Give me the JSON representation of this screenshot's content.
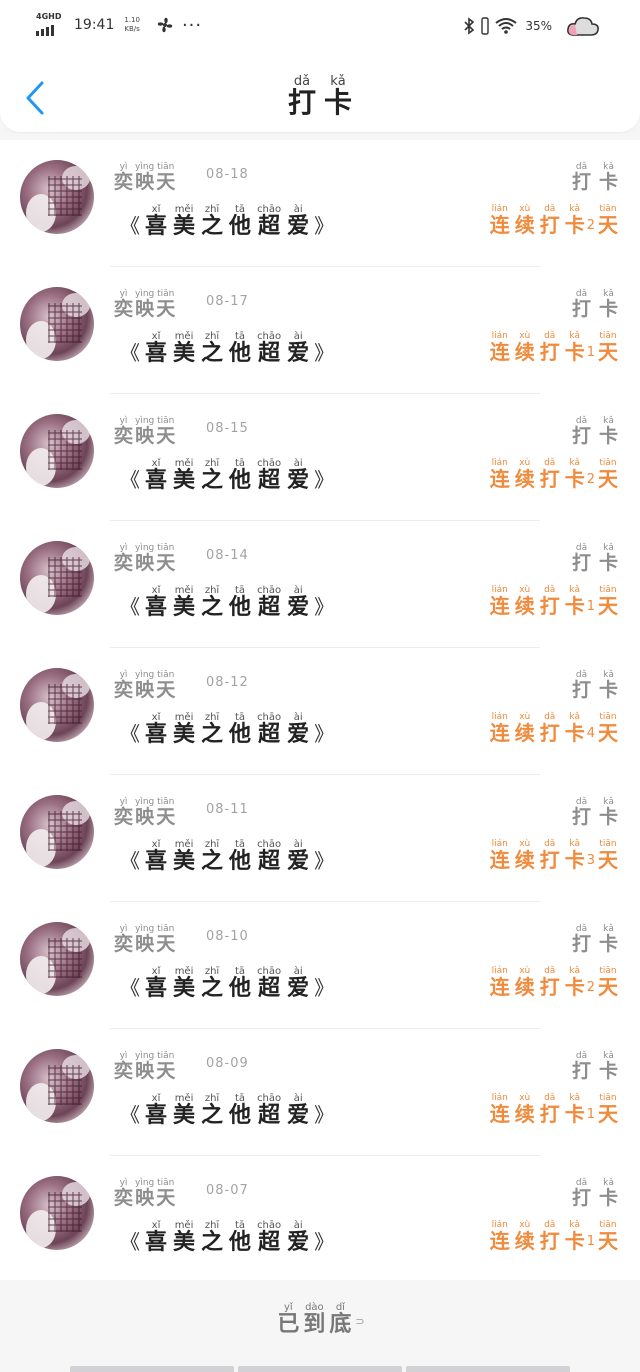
{
  "status_bar": {
    "network": "4GHD",
    "time": "19:41",
    "speed_value": "1.10",
    "speed_unit": "KB/s",
    "battery": "35%"
  },
  "header": {
    "title": [
      {
        "ch": "打",
        "py": "dǎ"
      },
      {
        "ch": "卡",
        "py": "kǎ"
      }
    ]
  },
  "labels": {
    "name": [
      {
        "ch": "奕",
        "py": "yì"
      },
      {
        "ch": "映",
        "py": "yìng"
      },
      {
        "ch": "天",
        "py": "tiān"
      }
    ],
    "book": [
      {
        "ch": "喜",
        "py": "xǐ"
      },
      {
        "ch": "美",
        "py": "měi"
      },
      {
        "ch": "之",
        "py": "zhī"
      },
      {
        "ch": "他",
        "py": "tā"
      },
      {
        "ch": "超",
        "py": "chāo"
      },
      {
        "ch": "爱",
        "py": "ài"
      }
    ],
    "book_open": "《",
    "book_close": "》",
    "tag": [
      {
        "ch": "打",
        "py": "dǎ"
      },
      {
        "ch": "卡",
        "py": "kǎ"
      }
    ],
    "streak_prefix": [
      {
        "ch": "连",
        "py": "lián"
      },
      {
        "ch": "续",
        "py": "xù"
      },
      {
        "ch": "打",
        "py": "dǎ"
      },
      {
        "ch": "卡",
        "py": "kǎ"
      }
    ],
    "streak_suffix": {
      "ch": "天",
      "py": "tiān"
    }
  },
  "checkins": [
    {
      "date": "08-18",
      "days": "2"
    },
    {
      "date": "08-17",
      "days": "1"
    },
    {
      "date": "08-15",
      "days": "2"
    },
    {
      "date": "08-14",
      "days": "1"
    },
    {
      "date": "08-12",
      "days": "4"
    },
    {
      "date": "08-11",
      "days": "3"
    },
    {
      "date": "08-10",
      "days": "2"
    },
    {
      "date": "08-09",
      "days": "1"
    },
    {
      "date": "08-07",
      "days": "1"
    }
  ],
  "footer": {
    "end_text": [
      {
        "ch": "已",
        "py": "yǐ"
      },
      {
        "ch": "到",
        "py": "dào"
      },
      {
        "ch": "底",
        "py": "dǐ"
      }
    ]
  },
  "colors": {
    "accent": "#f08a3c",
    "back_arrow": "#2196f3"
  }
}
